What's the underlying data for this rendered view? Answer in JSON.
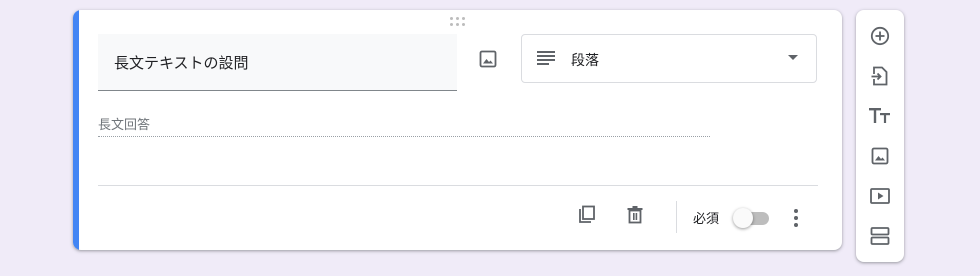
{
  "question": {
    "title": "長文テキストの設問",
    "type_label": "段落",
    "answer_hint": "長文回答",
    "required_label": "必須",
    "required": false
  },
  "icons": {
    "drag": "drag-handle-icon",
    "image": "image-icon",
    "type": "paragraph-lines-icon",
    "caret": "dropdown-arrow-icon",
    "duplicate": "copy-icon",
    "delete": "trash-icon",
    "more": "more-vertical-icon"
  },
  "toolbar": [
    {
      "name": "add-question",
      "icon": "add-circle-icon"
    },
    {
      "name": "import-questions",
      "icon": "import-icon"
    },
    {
      "name": "add-title",
      "icon": "title-text-icon"
    },
    {
      "name": "add-image",
      "icon": "image-icon"
    },
    {
      "name": "add-video",
      "icon": "video-icon"
    },
    {
      "name": "add-section",
      "icon": "section-icon"
    }
  ],
  "colors": {
    "background": "#f0ebf8",
    "accent": "#4285f4",
    "icon": "#5f6368"
  }
}
